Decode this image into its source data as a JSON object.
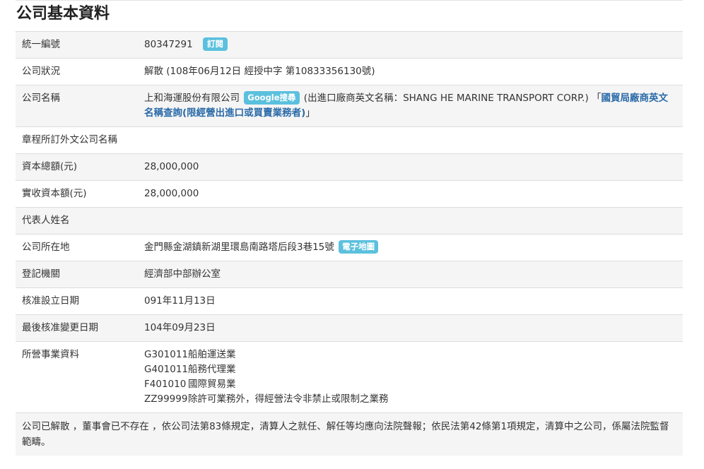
{
  "page": {
    "title": "公司基本資料"
  },
  "rows": {
    "ubn": {
      "label": "統一編號",
      "value": "80347291",
      "subscribe_badge": "訂閱"
    },
    "status": {
      "label": "公司狀況",
      "value": "解散 (108年06月12日 經授中字 第10833356130號)"
    },
    "name": {
      "label": "公司名稱",
      "value": "上和海運股份有限公司",
      "google_badge": "Google搜尋",
      "english_name_text": " (出進口廠商英文名稱：SHANG HE MARINE TRANSPORT CORP.) 「",
      "trade_link": "國貿局廠商英文名稱查詢(限經營出進口或買賣業務者)",
      "close_bracket": "」"
    },
    "foreign_name": {
      "label": "章程所訂外文公司名稱",
      "value": ""
    },
    "capital_total": {
      "label": "資本總額(元)",
      "value": "28,000,000"
    },
    "capital_paid": {
      "label": "實收資本額(元)",
      "value": "28,000,000"
    },
    "representative": {
      "label": "代表人姓名",
      "value": ""
    },
    "address": {
      "label": "公司所在地",
      "value": "金門縣金湖鎮新湖里環島南路塔后段3巷15號",
      "map_badge": "電子地圖"
    },
    "authority": {
      "label": "登記機關",
      "value": "經濟部中部辦公室"
    },
    "approval_date": {
      "label": "核准設立日期",
      "value": "091年11月13日"
    },
    "last_change_date": {
      "label": "最後核准變更日期",
      "value": "104年09月23日"
    },
    "business": {
      "label": "所營事業資料",
      "items": [
        {
          "code": "G301011",
          "desc": "船舶運送業"
        },
        {
          "code": "G401011",
          "desc": "船務代理業"
        },
        {
          "code": "F401010",
          "desc": "國際貿易業"
        },
        {
          "code": "ZZ99999",
          "desc": "除許可業務外，得經營法令非禁止或限制之業務"
        }
      ]
    }
  },
  "note": "公司已解散 ，董事會已不存在 ，依公司法第83條規定，清算人之就任、解任等均應向法院聲報；依民法第42條第1項規定，清算中之公司，係屬法院監督範疇。"
}
